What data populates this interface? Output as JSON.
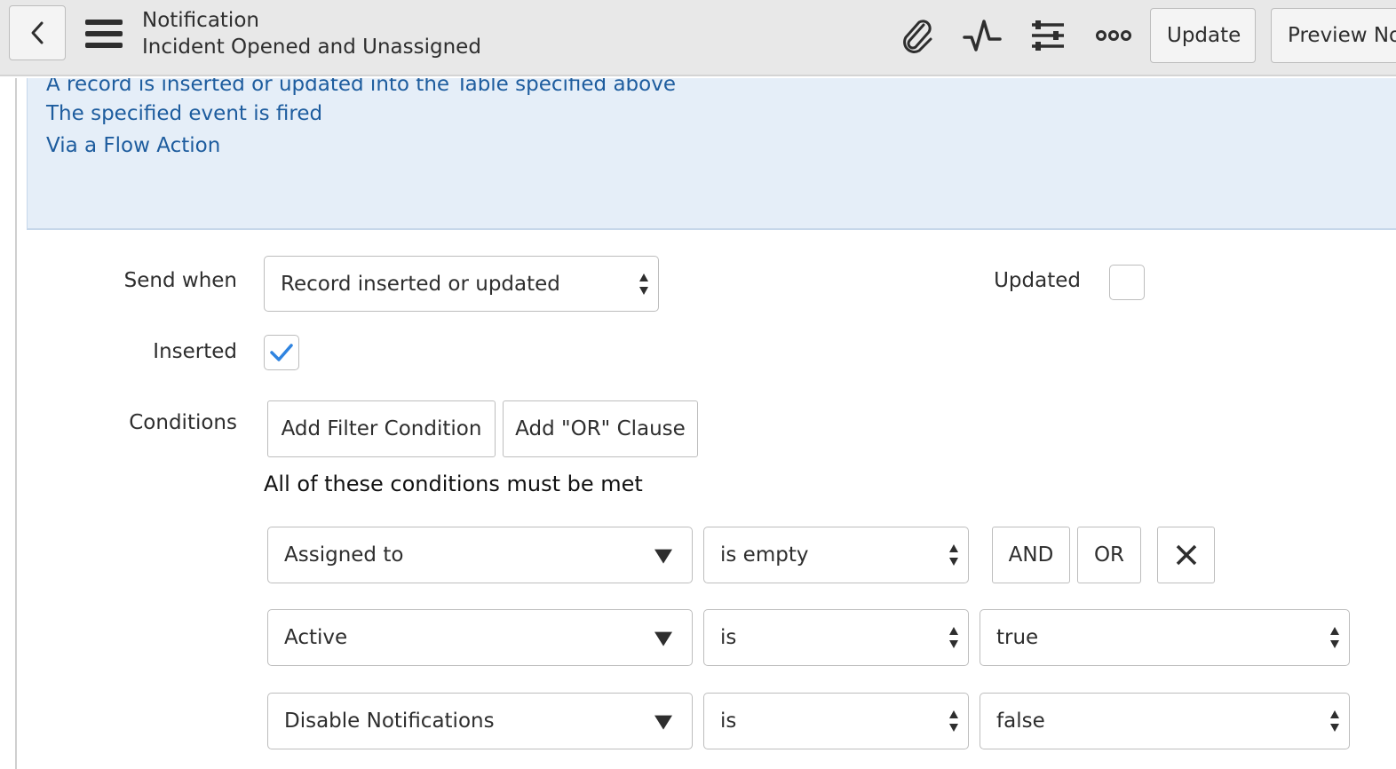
{
  "header": {
    "record_type": "Notification",
    "record_name": "Incident Opened and Unassigned",
    "update_label": "Update",
    "preview_label": "Preview No"
  },
  "info_panel": {
    "lines": [
      "A record is inserted or updated into the Table specified above",
      "The specified event is fired",
      "Via a Flow Action"
    ]
  },
  "form": {
    "send_when_label": "Send when",
    "send_when_value": "Record inserted or updated",
    "updated_label": "Updated",
    "updated_checked": false,
    "inserted_label": "Inserted",
    "inserted_checked": true,
    "conditions_label": "Conditions",
    "add_filter_label": "Add Filter Condition",
    "add_or_label": "Add \"OR\" Clause",
    "conditions_note": "All of these conditions must be met",
    "conditions": [
      {
        "field": "Assigned to",
        "operator": "is empty",
        "value": ""
      },
      {
        "field": "Active",
        "operator": "is",
        "value": "true"
      },
      {
        "field": "Disable Notifications",
        "operator": "is",
        "value": "false"
      }
    ],
    "and_label": "AND",
    "or_label": "OR"
  },
  "colors": {
    "info_text": "#1d5c9e",
    "info_bg": "#e5eef8",
    "check": "#2f84e0"
  }
}
